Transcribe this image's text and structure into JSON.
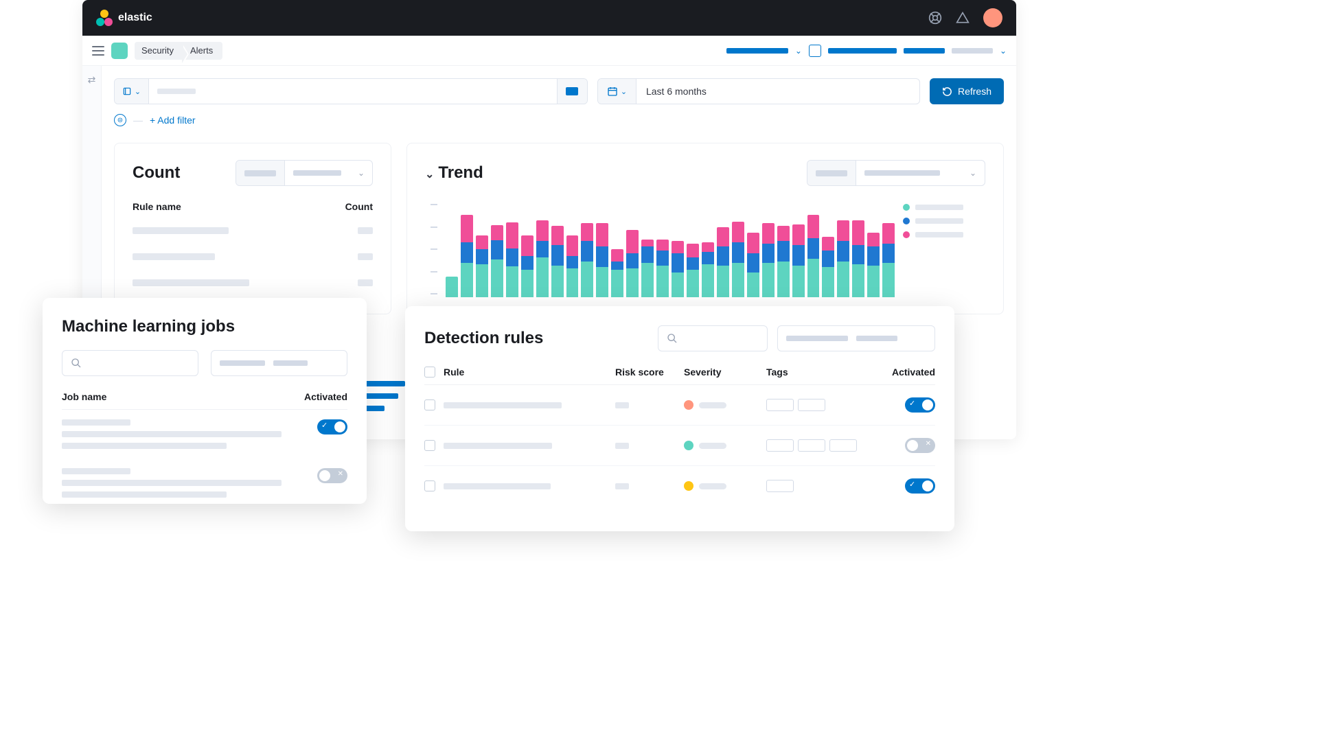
{
  "brand": "elastic",
  "breadcrumb": {
    "a": "Security",
    "b": "Alerts"
  },
  "date_range": "Last 6 months",
  "refresh_label": "Refresh",
  "add_filter_label": "+ Add filter",
  "count_panel": {
    "title": "Count",
    "col_rule": "Rule name",
    "col_count": "Count"
  },
  "trend_panel": {
    "title": "Trend"
  },
  "ml_card": {
    "title": "Machine learning jobs",
    "col_job": "Job name",
    "col_act": "Activated",
    "rows": [
      {
        "activated": true
      },
      {
        "activated": false
      }
    ]
  },
  "dr_card": {
    "title": "Detection rules",
    "cols": {
      "rule": "Rule",
      "risk": "Risk score",
      "sev": "Severity",
      "tags": "Tags",
      "act": "Activated"
    },
    "rows": [
      {
        "sev_color": "#ff957d",
        "tags": 2,
        "activated": true
      },
      {
        "sev_color": "#5dd4c0",
        "tags": 3,
        "activated": false
      },
      {
        "sev_color": "#fec514",
        "tags": 1,
        "activated": true
      }
    ]
  },
  "colors": {
    "teal": "#5dd4c0",
    "blue": "#1f78d1",
    "pink": "#f04e98",
    "primary": "#0077cc"
  },
  "chart_data": {
    "type": "bar",
    "stacked": true,
    "legend_position": "right",
    "series_colors": {
      "pink": "#f04e98",
      "blue": "#1f78d1",
      "teal": "#5dd4c0"
    },
    "bars": [
      {
        "teal": 30,
        "blue": 0,
        "pink": 0
      },
      {
        "teal": 50,
        "blue": 30,
        "pink": 40
      },
      {
        "teal": 48,
        "blue": 22,
        "pink": 20
      },
      {
        "teal": 55,
        "blue": 28,
        "pink": 22
      },
      {
        "teal": 45,
        "blue": 26,
        "pink": 38
      },
      {
        "teal": 40,
        "blue": 20,
        "pink": 30
      },
      {
        "teal": 58,
        "blue": 24,
        "pink": 30
      },
      {
        "teal": 46,
        "blue": 30,
        "pink": 28
      },
      {
        "teal": 42,
        "blue": 18,
        "pink": 30
      },
      {
        "teal": 52,
        "blue": 30,
        "pink": 26
      },
      {
        "teal": 44,
        "blue": 30,
        "pink": 34
      },
      {
        "teal": 40,
        "blue": 12,
        "pink": 18
      },
      {
        "teal": 42,
        "blue": 22,
        "pink": 34
      },
      {
        "teal": 50,
        "blue": 24,
        "pink": 10
      },
      {
        "teal": 46,
        "blue": 22,
        "pink": 16
      },
      {
        "teal": 36,
        "blue": 28,
        "pink": 18
      },
      {
        "teal": 40,
        "blue": 18,
        "pink": 20
      },
      {
        "teal": 48,
        "blue": 18,
        "pink": 14
      },
      {
        "teal": 46,
        "blue": 28,
        "pink": 28
      },
      {
        "teal": 50,
        "blue": 30,
        "pink": 30
      },
      {
        "teal": 36,
        "blue": 28,
        "pink": 30
      },
      {
        "teal": 50,
        "blue": 28,
        "pink": 30
      },
      {
        "teal": 52,
        "blue": 30,
        "pink": 22
      },
      {
        "teal": 46,
        "blue": 30,
        "pink": 30
      },
      {
        "teal": 56,
        "blue": 30,
        "pink": 34
      },
      {
        "teal": 44,
        "blue": 24,
        "pink": 20
      },
      {
        "teal": 52,
        "blue": 30,
        "pink": 30
      },
      {
        "teal": 48,
        "blue": 28,
        "pink": 36
      },
      {
        "teal": 46,
        "blue": 28,
        "pink": 20
      },
      {
        "teal": 50,
        "blue": 28,
        "pink": 30
      }
    ]
  }
}
